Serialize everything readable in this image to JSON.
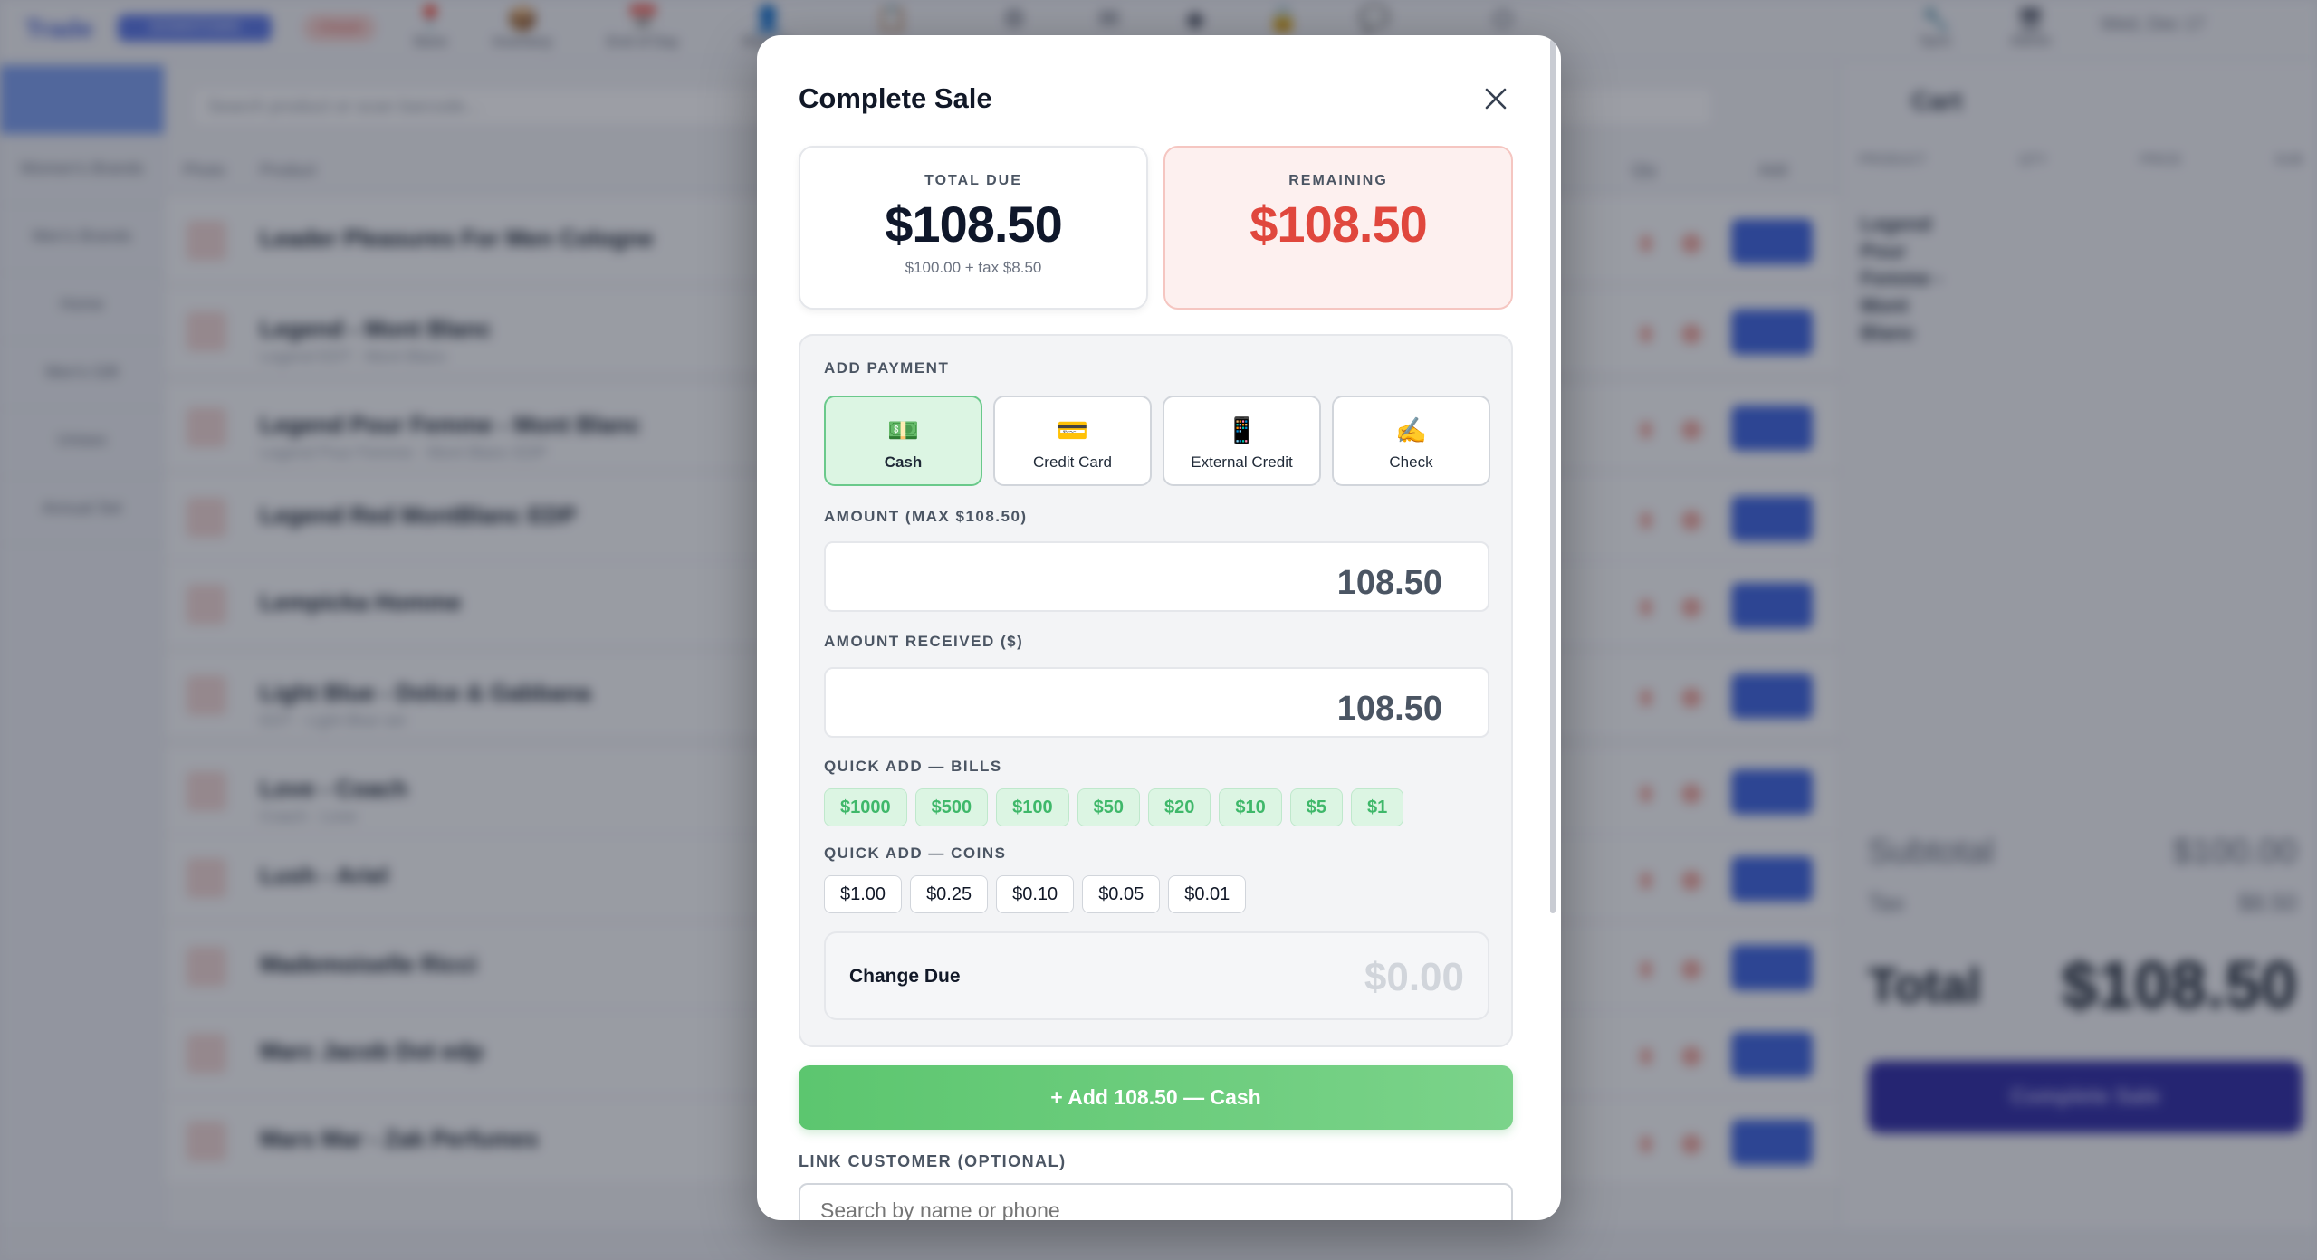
{
  "background": {
    "brand": "Trade",
    "store_badge": "DOWNTOWN",
    "status_pill": "Closed",
    "topnav": [
      {
        "icon": "📍",
        "label": "Store"
      },
      {
        "icon": "📦",
        "label": "Inventory"
      },
      {
        "icon": "📅",
        "label": "End of Day"
      },
      {
        "icon": "👤",
        "label": "Reports"
      },
      {
        "icon": "📋",
        "label": ""
      },
      {
        "icon": "⚙",
        "label": ""
      },
      {
        "icon": "✉",
        "label": ""
      },
      {
        "icon": "◆",
        "label": ""
      },
      {
        "icon": "🔒",
        "label": ""
      },
      {
        "icon": "💬",
        "label": ""
      },
      {
        "icon": "⏻",
        "label": ""
      }
    ],
    "top_right": [
      {
        "icon": "🔧",
        "label": "Sync"
      },
      {
        "icon": "🖥",
        "label": "Admin"
      }
    ],
    "date": "Wed, Dec 17",
    "search_placeholder": "Search product or scan barcode...",
    "table_headers": {
      "photo": "Photo",
      "product": "Product",
      "qty": "Qty",
      "add": "Add"
    },
    "categories": [
      "Women's Brands",
      "Men's Brands",
      "Home",
      "Men's Gift",
      "Unisex",
      "Annual Set"
    ],
    "products": [
      {
        "name": "Leader Pleasures For Men Cologne",
        "sub": ""
      },
      {
        "name": "Legend - Mont Blanc",
        "sub": "Legend EDT - Mont Blanc"
      },
      {
        "name": "Legend Pour Femme - Mont Blanc",
        "sub": "Legend Pour Femme - Mont Blanc EDP"
      },
      {
        "name": "Legend Red MontBlanc EDP",
        "sub": ""
      },
      {
        "name": "Lempicka Homme",
        "sub": ""
      },
      {
        "name": "Light Blue - Dolce & Gabbana",
        "sub": "EDT - Light Blue set"
      },
      {
        "name": "Love - Coach",
        "sub": "Coach - Love"
      },
      {
        "name": "Lush - Ariel",
        "sub": ""
      },
      {
        "name": "Mademoiselle Ricci",
        "sub": ""
      },
      {
        "name": "Marc Jacob Dot edp",
        "sub": ""
      },
      {
        "name": "Mars Mar - Zak Perfumes",
        "sub": ""
      }
    ],
    "cart": {
      "title": "Cart",
      "headers": [
        "PRODUCT",
        "QTY",
        "PRICE",
        "SUB"
      ],
      "item": "Legend Pour Femme - Mont Blanc",
      "subtotal_label": "Subtotal",
      "subtotal_value": "$100.00",
      "tax_label": "Tax",
      "tax_value": "$8.50",
      "total_label": "Total",
      "total_value": "$108.50",
      "complete_label": "Complete Sale"
    }
  },
  "modal": {
    "title": "Complete Sale",
    "total_due": {
      "label": "TOTAL DUE",
      "amount": "$108.50",
      "note": "$100.00 + tax $8.50"
    },
    "remaining": {
      "label": "REMAINING",
      "amount": "$108.50"
    },
    "add_payment_label": "ADD PAYMENT",
    "methods": [
      {
        "icon": "💵",
        "label": "Cash",
        "selected": true
      },
      {
        "icon": "💳",
        "label": "Credit Card",
        "selected": false
      },
      {
        "icon": "📱",
        "label": "External Credit",
        "selected": false
      },
      {
        "icon": "✍️",
        "label": "Check",
        "selected": false
      }
    ],
    "amount_label": "AMOUNT (MAX $108.50)",
    "amount_value": "108.50",
    "received_label": "AMOUNT RECEIVED ($)",
    "received_value": "108.50",
    "bills_label": "QUICK ADD — BILLS",
    "bills": [
      "$1000",
      "$500",
      "$100",
      "$50",
      "$20",
      "$10",
      "$5",
      "$1"
    ],
    "coins_label": "QUICK ADD — COINS",
    "coins": [
      "$1.00",
      "$0.25",
      "$0.10",
      "$0.05",
      "$0.01"
    ],
    "change_label": "Change Due",
    "change_value": "$0.00",
    "add_button": "+ Add 108.50 — Cash",
    "link_customer_label": "LINK CUSTOMER (OPTIONAL)",
    "customer_placeholder": "Search by name or phone",
    "colors": {
      "accent_green": "#5cc66f",
      "remaining_red": "#e0473d",
      "selected_bg": "#dcf5e3"
    }
  }
}
